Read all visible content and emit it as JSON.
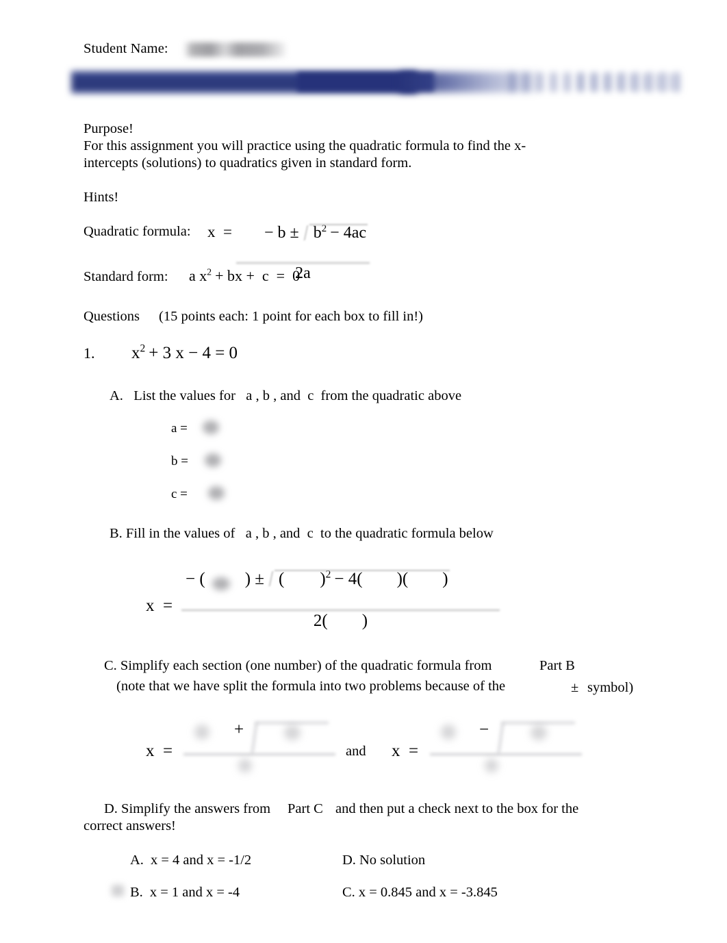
{
  "document": {
    "type": "math-worksheet",
    "header": {
      "student_name_label": "Student Name:",
      "student_name_value": "",
      "student_name_redacted": true,
      "banner_redacted": true,
      "banner_color": "#2b3878",
      "banner_text": ""
    },
    "purpose": {
      "heading": "Purpose!",
      "body": "For this assignment you will practice using the quadratic formula to find the x-intercepts (solutions) to quadratics given in standard form."
    },
    "hints": {
      "heading": "Hints!",
      "quadratic_formula_label": "Quadratic formula:",
      "quadratic_formula_lhs": "x  =",
      "quadratic_formula_numerator_pre": "− b ±",
      "quadratic_formula_radicand": "b",
      "quadratic_formula_radicand_exp": "2",
      "quadratic_formula_radicand_post": "− 4ac",
      "quadratic_formula_denominator": "2a",
      "standard_form_label": "Standard form:",
      "standard_form_expr_a": "a x",
      "standard_form_exp": "2",
      "standard_form_expr_b": "+ bx +  c  =  0"
    },
    "questions_header": {
      "label": "Questions",
      "points_note": "(15 points each: 1 point for each box to fill in!)"
    },
    "question1": {
      "number": "1.",
      "equation_lead": "x",
      "equation_exp": "2",
      "equation_rest": "+ 3 x − 4 = 0",
      "partA": {
        "label": "A.   List the values for   a , b , and  c  from the quadratic above",
        "fields": [
          {
            "label": "a =",
            "value": "",
            "redacted": true
          },
          {
            "label": "b =",
            "value": "",
            "redacted": true
          },
          {
            "label": "c =",
            "value": "",
            "redacted": true
          }
        ]
      },
      "partB": {
        "label": "B. Fill in the values of   a , b , and  c  to the quadratic formula below",
        "lhs": "x  =",
        "numerator_pre": "− (",
        "numerator_blank1": "",
        "numerator_mid": ") ±",
        "radicand_open": "(",
        "radicand_blank": "",
        "radicand_close": ")",
        "radicand_exp": "2",
        "radicand_minus": "− 4(",
        "radicand_blank2": "",
        "radicand_close2": ")(",
        "radicand_blank3": "",
        "radicand_close3": ")",
        "denominator": "2(        )",
        "blank1_redacted": true
      },
      "partC": {
        "line1": "C. Simplify each section (one number) of the quadratic formula from",
        "line1_ref": "Part B",
        "line2": "(note that we have split the formula into two problems because of the",
        "line2_symbol": "±",
        "line2_end": "symbol)",
        "lhs1": "x  =",
        "operator1": "+",
        "conjunction": "and",
        "lhs2": "x  =",
        "operator2": "−",
        "values_redacted": true
      },
      "partD": {
        "line1": "D. Simplify the answers from",
        "line1_ref": "Part C",
        "line1_end": "and then put a check next to the box for the",
        "line2": "correct answers!",
        "choices": [
          {
            "letter": "A.",
            "text": "x = 4 and x = -1/2",
            "checked": false
          },
          {
            "letter": "B.",
            "text": "x = 1 and x = -4",
            "checked": true
          },
          {
            "letter": "D.",
            "text": "No solution",
            "checked": false
          },
          {
            "letter": "C.",
            "text": "x = 0.845 and x = -3.845",
            "checked": false
          }
        ]
      }
    }
  }
}
